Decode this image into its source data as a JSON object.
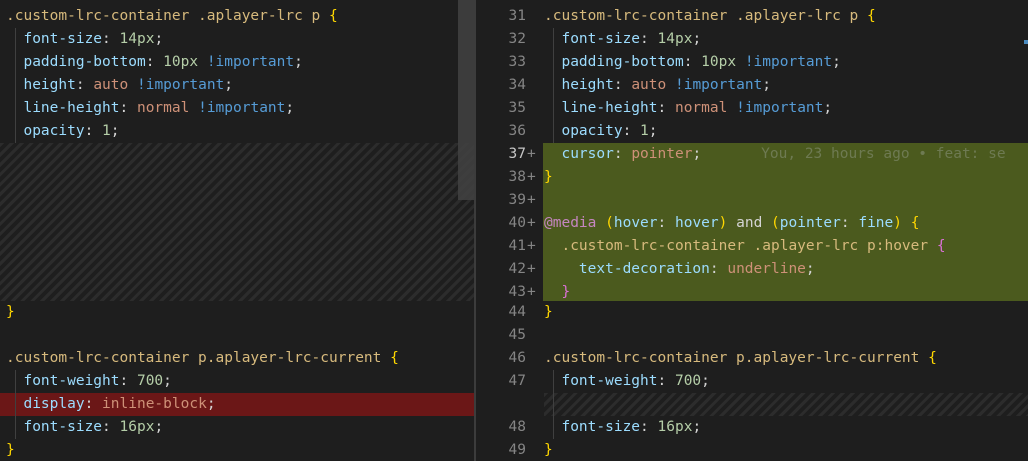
{
  "left": {
    "lines": [
      {
        "segs": [
          {
            "t": ".custom-lrc-container .aplayer-lrc p ",
            "c": "sel"
          },
          {
            "t": "{",
            "c": "b1"
          }
        ]
      },
      {
        "segs": [
          {
            "t": "  ",
            "c": "pun"
          },
          {
            "t": "font-size",
            "c": "prop"
          },
          {
            "t": ": ",
            "c": "pun"
          },
          {
            "t": "14px",
            "c": "num"
          },
          {
            "t": ";",
            "c": "pun"
          }
        ]
      },
      {
        "segs": [
          {
            "t": "  ",
            "c": "pun"
          },
          {
            "t": "padding-bottom",
            "c": "prop"
          },
          {
            "t": ": ",
            "c": "pun"
          },
          {
            "t": "10px",
            "c": "num"
          },
          {
            "t": " ",
            "c": "pun"
          },
          {
            "t": "!important",
            "c": "imp"
          },
          {
            "t": ";",
            "c": "pun"
          }
        ]
      },
      {
        "segs": [
          {
            "t": "  ",
            "c": "pun"
          },
          {
            "t": "height",
            "c": "prop"
          },
          {
            "t": ": ",
            "c": "pun"
          },
          {
            "t": "auto",
            "c": "kw"
          },
          {
            "t": " ",
            "c": "pun"
          },
          {
            "t": "!important",
            "c": "imp"
          },
          {
            "t": ";",
            "c": "pun"
          }
        ]
      },
      {
        "segs": [
          {
            "t": "  ",
            "c": "pun"
          },
          {
            "t": "line-height",
            "c": "prop"
          },
          {
            "t": ": ",
            "c": "pun"
          },
          {
            "t": "normal",
            "c": "kw"
          },
          {
            "t": " ",
            "c": "pun"
          },
          {
            "t": "!important",
            "c": "imp"
          },
          {
            "t": ";",
            "c": "pun"
          }
        ]
      },
      {
        "segs": [
          {
            "t": "  ",
            "c": "pun"
          },
          {
            "t": "opacity",
            "c": "prop"
          },
          {
            "t": ": ",
            "c": "pun"
          },
          {
            "t": "1",
            "c": "num"
          },
          {
            "t": ";",
            "c": "pun"
          }
        ]
      },
      {
        "segs": [
          {
            "t": "}",
            "c": "b1"
          }
        ]
      },
      {
        "segs": []
      },
      {
        "segs": [
          {
            "t": ".custom-lrc-container p.aplayer-lrc-current ",
            "c": "sel"
          },
          {
            "t": "{",
            "c": "b1"
          }
        ]
      },
      {
        "segs": [
          {
            "t": "  ",
            "c": "pun"
          },
          {
            "t": "font-weight",
            "c": "prop"
          },
          {
            "t": ": ",
            "c": "pun"
          },
          {
            "t": "700",
            "c": "num"
          },
          {
            "t": ";",
            "c": "pun"
          }
        ]
      },
      {
        "segs": [
          {
            "t": "  ",
            "c": "pun"
          },
          {
            "t": "display",
            "c": "prop"
          },
          {
            "t": ": ",
            "c": "pun"
          },
          {
            "t": "inline-block",
            "c": "kw"
          },
          {
            "t": ";",
            "c": "pun"
          }
        ]
      },
      {
        "segs": [
          {
            "t": "  ",
            "c": "pun"
          },
          {
            "t": "font-size",
            "c": "prop"
          },
          {
            "t": ": ",
            "c": "pun"
          },
          {
            "t": "16px",
            "c": "num"
          },
          {
            "t": ";",
            "c": "pun"
          }
        ]
      },
      {
        "segs": [
          {
            "t": "}",
            "c": "b1"
          }
        ]
      }
    ]
  },
  "right": {
    "lines": [
      {
        "num": "31",
        "mark": "",
        "segs": [
          {
            "t": ".custom-lrc-container .aplayer-lrc p ",
            "c": "sel"
          },
          {
            "t": "{",
            "c": "b1"
          }
        ]
      },
      {
        "num": "32",
        "mark": "",
        "segs": [
          {
            "t": "  ",
            "c": "pun"
          },
          {
            "t": "font-size",
            "c": "prop"
          },
          {
            "t": ": ",
            "c": "pun"
          },
          {
            "t": "14px",
            "c": "num"
          },
          {
            "t": ";",
            "c": "pun"
          }
        ]
      },
      {
        "num": "33",
        "mark": "",
        "segs": [
          {
            "t": "  ",
            "c": "pun"
          },
          {
            "t": "padding-bottom",
            "c": "prop"
          },
          {
            "t": ": ",
            "c": "pun"
          },
          {
            "t": "10px",
            "c": "num"
          },
          {
            "t": " ",
            "c": "pun"
          },
          {
            "t": "!important",
            "c": "imp"
          },
          {
            "t": ";",
            "c": "pun"
          }
        ]
      },
      {
        "num": "34",
        "mark": "",
        "segs": [
          {
            "t": "  ",
            "c": "pun"
          },
          {
            "t": "height",
            "c": "prop"
          },
          {
            "t": ": ",
            "c": "pun"
          },
          {
            "t": "auto",
            "c": "kw"
          },
          {
            "t": " ",
            "c": "pun"
          },
          {
            "t": "!important",
            "c": "imp"
          },
          {
            "t": ";",
            "c": "pun"
          }
        ]
      },
      {
        "num": "35",
        "mark": "",
        "segs": [
          {
            "t": "  ",
            "c": "pun"
          },
          {
            "t": "line-height",
            "c": "prop"
          },
          {
            "t": ": ",
            "c": "pun"
          },
          {
            "t": "normal",
            "c": "kw"
          },
          {
            "t": " ",
            "c": "pun"
          },
          {
            "t": "!important",
            "c": "imp"
          },
          {
            "t": ";",
            "c": "pun"
          }
        ]
      },
      {
        "num": "36",
        "mark": "",
        "segs": [
          {
            "t": "  ",
            "c": "pun"
          },
          {
            "t": "opacity",
            "c": "prop"
          },
          {
            "t": ": ",
            "c": "pun"
          },
          {
            "t": "1",
            "c": "num"
          },
          {
            "t": ";",
            "c": "pun"
          }
        ]
      },
      {
        "num": "37",
        "mark": "+",
        "segs": [
          {
            "t": "  ",
            "c": "pun"
          },
          {
            "t": "cursor",
            "c": "prop"
          },
          {
            "t": ": ",
            "c": "pun"
          },
          {
            "t": "pointer",
            "c": "kw"
          },
          {
            "t": ";",
            "c": "pun"
          }
        ],
        "blame": "You, 23 hours ago • feat: se"
      },
      {
        "num": "38",
        "mark": "+",
        "segs": [
          {
            "t": "}",
            "c": "b1"
          }
        ]
      },
      {
        "num": "39",
        "mark": "+",
        "segs": []
      },
      {
        "num": "40",
        "mark": "+",
        "segs": [
          {
            "t": "@media",
            "c": "at"
          },
          {
            "t": " ",
            "c": "pun"
          },
          {
            "t": "(",
            "c": "b1"
          },
          {
            "t": "hover",
            "c": "media"
          },
          {
            "t": ": ",
            "c": "pun"
          },
          {
            "t": "hover",
            "c": "media"
          },
          {
            "t": ")",
            "c": "b1"
          },
          {
            "t": " and ",
            "c": "pun"
          },
          {
            "t": "(",
            "c": "b1"
          },
          {
            "t": "pointer",
            "c": "media"
          },
          {
            "t": ": ",
            "c": "pun"
          },
          {
            "t": "fine",
            "c": "media"
          },
          {
            "t": ")",
            "c": "b1"
          },
          {
            "t": " ",
            "c": "pun"
          },
          {
            "t": "{",
            "c": "b1"
          }
        ]
      },
      {
        "num": "41",
        "mark": "+",
        "segs": [
          {
            "t": "  ",
            "c": "pun"
          },
          {
            "t": ".custom-lrc-container .aplayer-lrc p:hover ",
            "c": "sel"
          },
          {
            "t": "{",
            "c": "b2"
          }
        ]
      },
      {
        "num": "42",
        "mark": "+",
        "segs": [
          {
            "t": "    ",
            "c": "pun"
          },
          {
            "t": "text-decoration",
            "c": "prop"
          },
          {
            "t": ": ",
            "c": "pun"
          },
          {
            "t": "underline",
            "c": "kw"
          },
          {
            "t": ";",
            "c": "pun"
          }
        ]
      },
      {
        "num": "43",
        "mark": "+",
        "segs": [
          {
            "t": "  ",
            "c": "pun"
          },
          {
            "t": "}",
            "c": "b2"
          }
        ]
      },
      {
        "num": "44",
        "mark": "",
        "segs": [
          {
            "t": "}",
            "c": "b1"
          }
        ]
      },
      {
        "num": "45",
        "mark": "",
        "segs": []
      },
      {
        "num": "46",
        "mark": "",
        "segs": [
          {
            "t": ".custom-lrc-container p.aplayer-lrc-current ",
            "c": "sel"
          },
          {
            "t": "{",
            "c": "b1"
          }
        ]
      },
      {
        "num": "47",
        "mark": "",
        "segs": [
          {
            "t": "  ",
            "c": "pun"
          },
          {
            "t": "font-weight",
            "c": "prop"
          },
          {
            "t": ": ",
            "c": "pun"
          },
          {
            "t": "700",
            "c": "num"
          },
          {
            "t": ";",
            "c": "pun"
          }
        ]
      },
      {
        "num": "48",
        "mark": "",
        "segs": [
          {
            "t": "  ",
            "c": "pun"
          },
          {
            "t": "font-size",
            "c": "prop"
          },
          {
            "t": ": ",
            "c": "pun"
          },
          {
            "t": "16px",
            "c": "num"
          },
          {
            "t": ";",
            "c": "pun"
          }
        ]
      },
      {
        "num": "49",
        "mark": "",
        "segs": [
          {
            "t": "}",
            "c": "b1"
          }
        ]
      }
    ]
  },
  "colors": {
    "added_background": "#4b5a1e",
    "removed_background": "#6b1717",
    "editor_background": "#1e1e1e"
  }
}
